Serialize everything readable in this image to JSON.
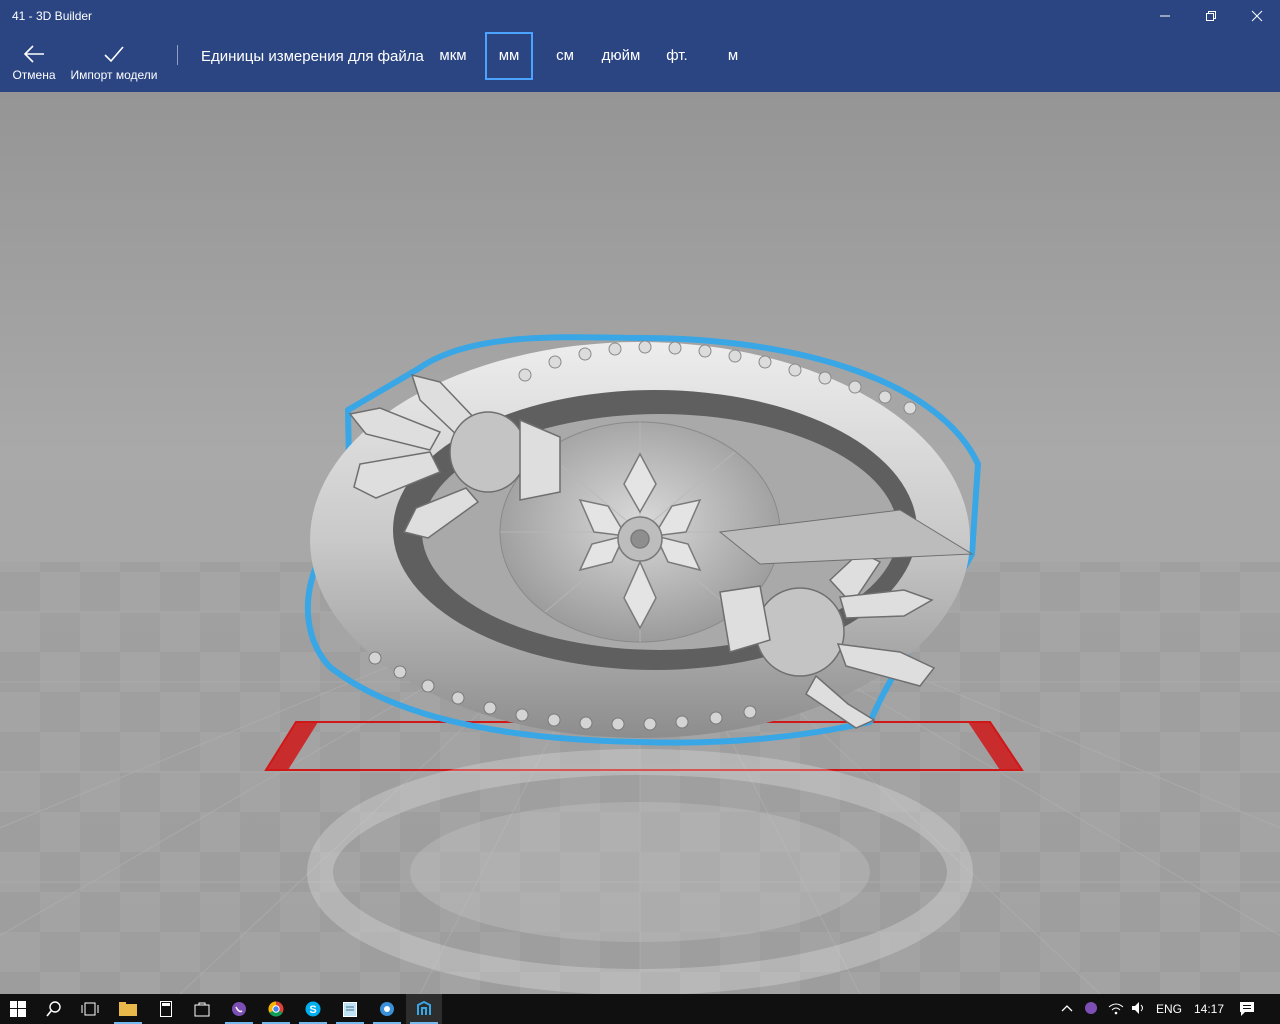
{
  "window": {
    "title": "41 - 3D Builder"
  },
  "commands": {
    "cancel_label": "Отмена",
    "import_label": "Импорт модели"
  },
  "units": {
    "caption": "Единицы измерения для файла",
    "options": [
      "мкм",
      "мм",
      "см",
      "дюйм",
      "фт.",
      "м"
    ],
    "selected": "мм"
  },
  "viewport": {
    "model_outline_color": "#39a6e6",
    "plate_border_color": "#d01818"
  },
  "taskbar": {
    "language": "ENG",
    "time": "14:17",
    "apps": [
      "file-explorer",
      "calculator",
      "store",
      "viber",
      "chrome",
      "skype",
      "notepad",
      "tools-app",
      "3d-builder"
    ],
    "active_app": "3d-builder"
  }
}
